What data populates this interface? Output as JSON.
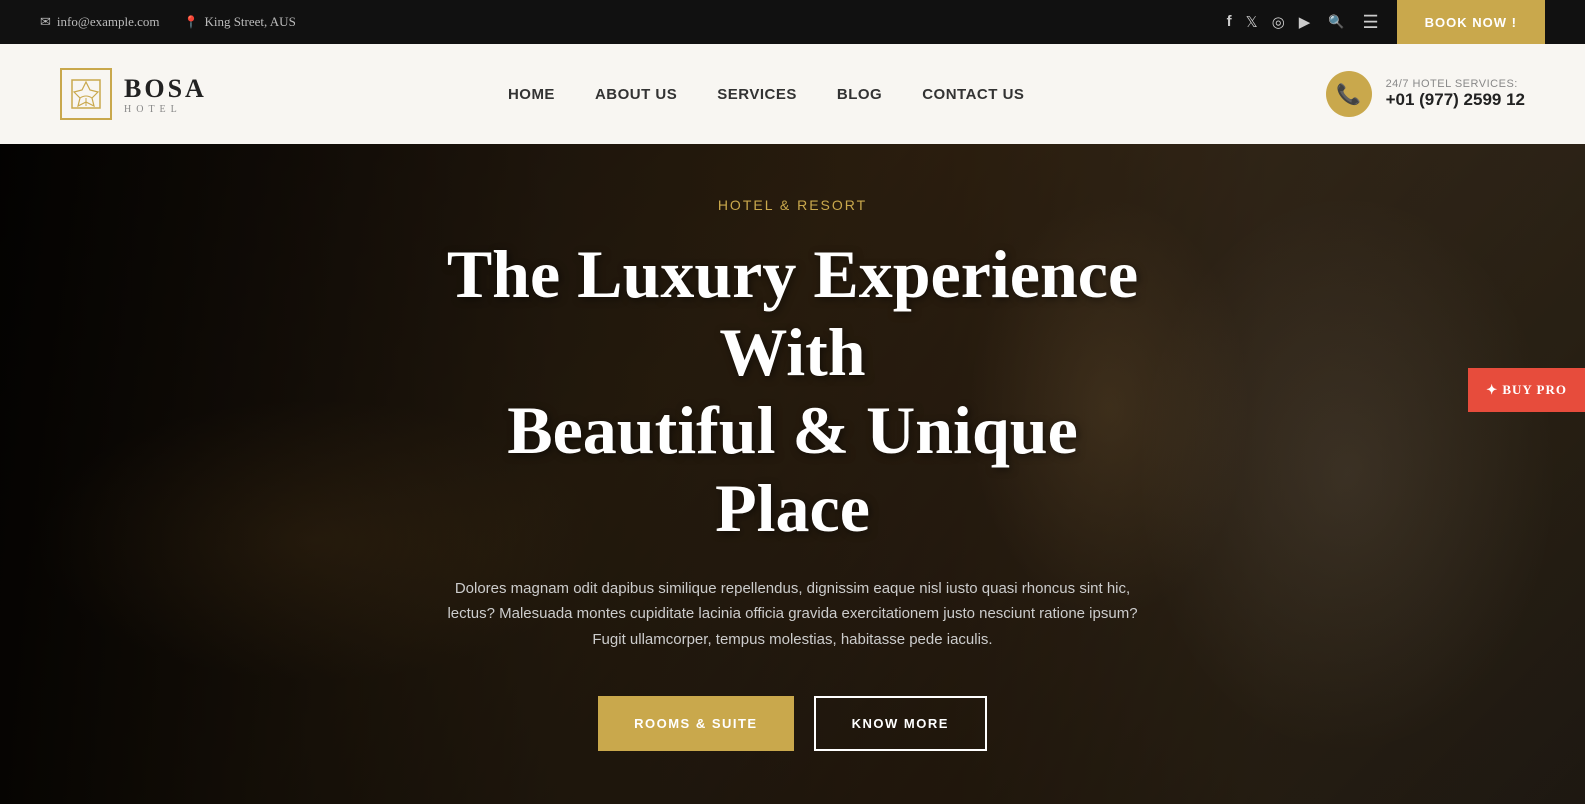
{
  "topbar": {
    "email": "info@example.com",
    "address": "King Street, AUS",
    "book_now": "BOOK NOW !"
  },
  "navbar": {
    "logo_name": "BOSA",
    "logo_sub": "HOTEL",
    "nav_home": "HOME",
    "nav_about": "ABOUT US",
    "nav_services": "SERVICES",
    "nav_blog": "BLOG",
    "nav_contact": "CONTACT US",
    "phone_label": "24/7 HOTEL SERVICES:",
    "phone_number": "+01 (977) 2599 12"
  },
  "hero": {
    "subtitle": "HOTEL & RESORT",
    "title_line1": "The Luxury Experience With",
    "title_line2": "Beautiful & Unique Place",
    "description": "Dolores magnam odit dapibus similique repellendus, dignissim eaque nisl iusto quasi rhoncus sint hic, lectus? Malesuada montes cupiditate lacinia officia gravida exercitationem justo nesciunt ratione ipsum? Fugit ullamcorper, tempus molestias, habitasse pede iaculis.",
    "btn_rooms": "ROOMS & SUITE",
    "btn_know": "KNOW MORE"
  },
  "buy_pro": {
    "label": "✦ BUY PRO"
  }
}
